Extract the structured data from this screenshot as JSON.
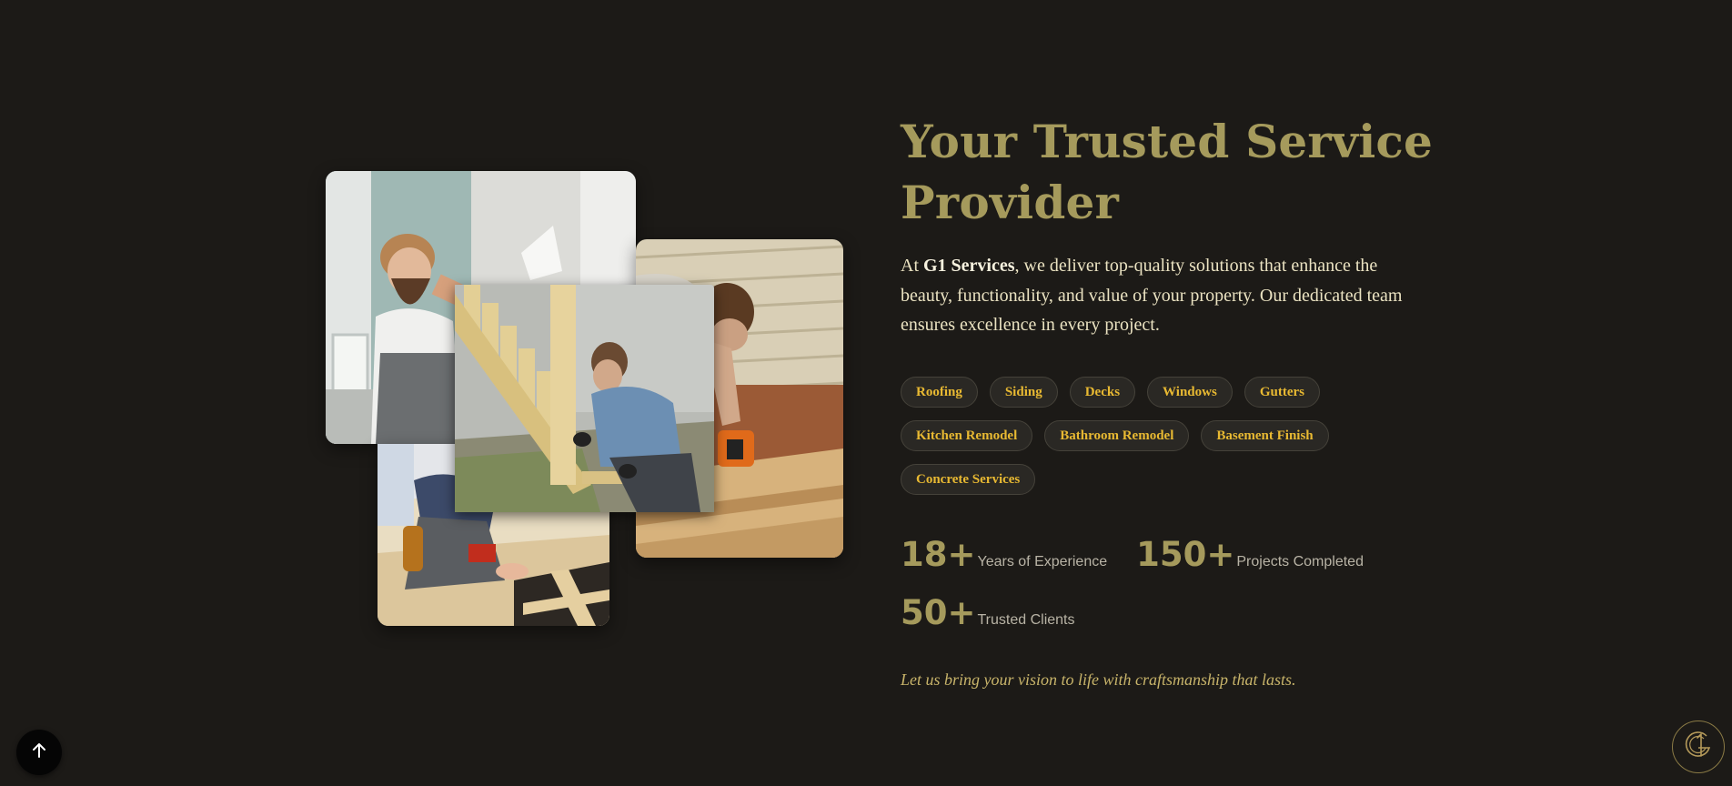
{
  "images": {
    "photo_1_alt": "Worker with cap",
    "photo_2_alt": "Building stairs",
    "photo_3_alt": "Siding installation",
    "photo_4_alt": "Deck construction"
  },
  "hero": {
    "title": "Your Trusted Service Provider",
    "intro_prefix": "At ",
    "company": "G1 Services",
    "intro_suffix": ", we deliver top-quality solutions that enhance the beauty, functionality, and value of your property. Our dedicated team ensures excellence in every project."
  },
  "services": [
    "Roofing",
    "Siding",
    "Decks",
    "Windows",
    "Gutters",
    "Kitchen Remodel",
    "Bathroom Remodel",
    "Basement Finish",
    "Concrete Services"
  ],
  "stats": [
    {
      "number": "18+",
      "label": "Years of Experience"
    },
    {
      "number": "150+",
      "label": "Projects Completed"
    },
    {
      "number": "50+",
      "label": "Trusted Clients"
    }
  ],
  "tagline": "Let us bring your vision to life with craftsmanship that lasts.",
  "controls": {
    "scroll_top_icon": "arrow-up-icon",
    "logo_icon": "g1-logo-icon"
  },
  "colors": {
    "background": "#1c1a17",
    "title": "#a59a5c",
    "tag_text": "#e8b932",
    "tag_bg": "#2a2824",
    "body_text": "#ebe3c2"
  }
}
